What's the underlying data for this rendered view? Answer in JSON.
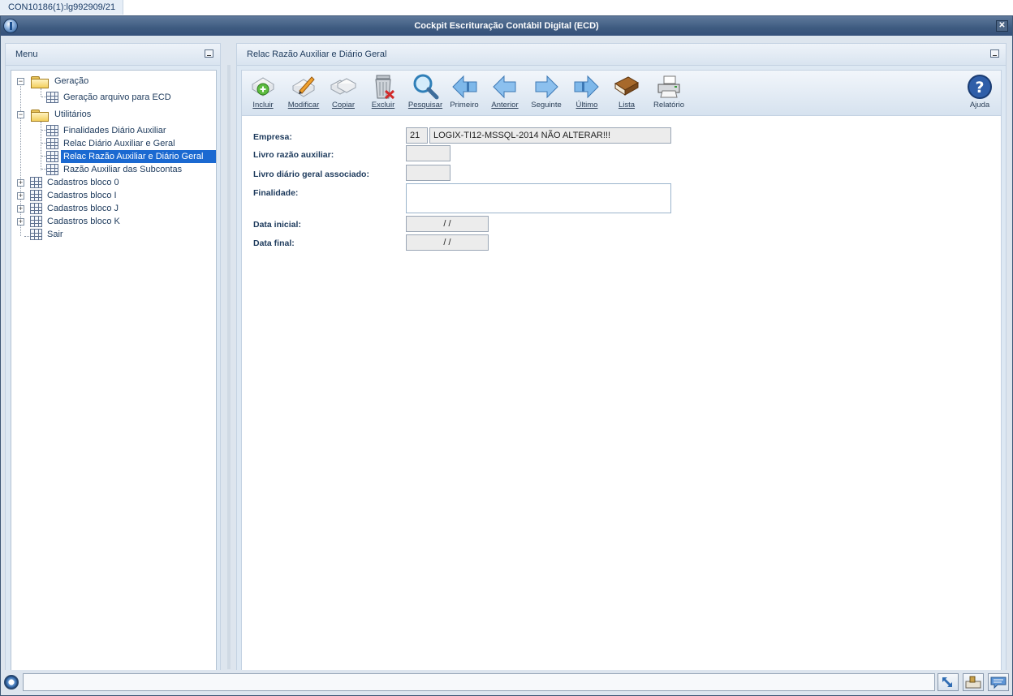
{
  "tab": {
    "label": "CON10186(1):lg992909/21"
  },
  "window": {
    "title": "Cockpit Escrituração Contábil Digital (ECD)",
    "close_label": "✕"
  },
  "menu": {
    "header": "Menu",
    "tree": [
      {
        "label": "Geração",
        "type": "folder",
        "expander": "−"
      },
      {
        "label": "Geração arquivo para ECD",
        "type": "item"
      },
      {
        "label": "Utilitários",
        "type": "folder",
        "expander": "−"
      },
      {
        "label": "Finalidades Diário Auxiliar",
        "type": "item"
      },
      {
        "label": "Relac Diário Auxiliar e Geral",
        "type": "item"
      },
      {
        "label": "Relac Razão Auxiliar e Diário Geral",
        "type": "item",
        "selected": true
      },
      {
        "label": "Razão Auxiliar das Subcontas",
        "type": "item"
      },
      {
        "label": "Cadastros bloco 0",
        "type": "item",
        "expander": "+"
      },
      {
        "label": "Cadastros bloco I",
        "type": "item",
        "expander": "+"
      },
      {
        "label": "Cadastros bloco J",
        "type": "item",
        "expander": "+"
      },
      {
        "label": "Cadastros bloco K",
        "type": "item",
        "expander": "+"
      },
      {
        "label": "Sair",
        "type": "item"
      }
    ]
  },
  "main": {
    "header": "Relac Razão Auxiliar e Diário Geral",
    "toolbar": [
      {
        "id": "incluir",
        "label": "Incluir",
        "icon": "add-document-icon"
      },
      {
        "id": "modificar",
        "label": "Modificar",
        "icon": "edit-pencil-icon"
      },
      {
        "id": "copiar",
        "label": "Copiar",
        "icon": "copy-icon"
      },
      {
        "id": "excluir",
        "label": "Excluir",
        "icon": "trash-icon"
      },
      {
        "id": "pesquisar",
        "label": "Pesquisar",
        "icon": "magnifier-icon"
      },
      {
        "id": "primeiro",
        "label": "Primeiro",
        "icon": "first-arrow-icon"
      },
      {
        "id": "anterior",
        "label": "Anterior",
        "icon": "previous-arrow-icon"
      },
      {
        "id": "seguinte",
        "label": "Seguinte",
        "icon": "next-arrow-icon"
      },
      {
        "id": "ultimo",
        "label": "Último",
        "icon": "last-arrow-icon"
      },
      {
        "id": "lista",
        "label": "Lista",
        "icon": "book-icon"
      },
      {
        "id": "relatorio",
        "label": "Relatório",
        "icon": "printer-icon"
      },
      {
        "id": "ajuda",
        "label": "Ajuda",
        "icon": "help-icon"
      }
    ],
    "form": {
      "empresa_label": "Empresa:",
      "empresa_code": "21",
      "empresa_name": "LOGIX-TI12-MSSQL-2014 NÃO ALTERAR!!!",
      "livro_razao_label": "Livro razão auxiliar:",
      "livro_razao_value": "",
      "livro_diario_label": "Livro diário geral associado:",
      "livro_diario_value": "",
      "finalidade_label": "Finalidade:",
      "finalidade_value": "",
      "data_inicial_label": "Data inicial:",
      "data_inicial_value": "/ /",
      "data_final_label": "Data final:",
      "data_final_value": "/ /"
    }
  },
  "colors": {
    "titlebar": "#3e5b80",
    "selection": "#1b69d1",
    "panel": "#dde8f3"
  }
}
